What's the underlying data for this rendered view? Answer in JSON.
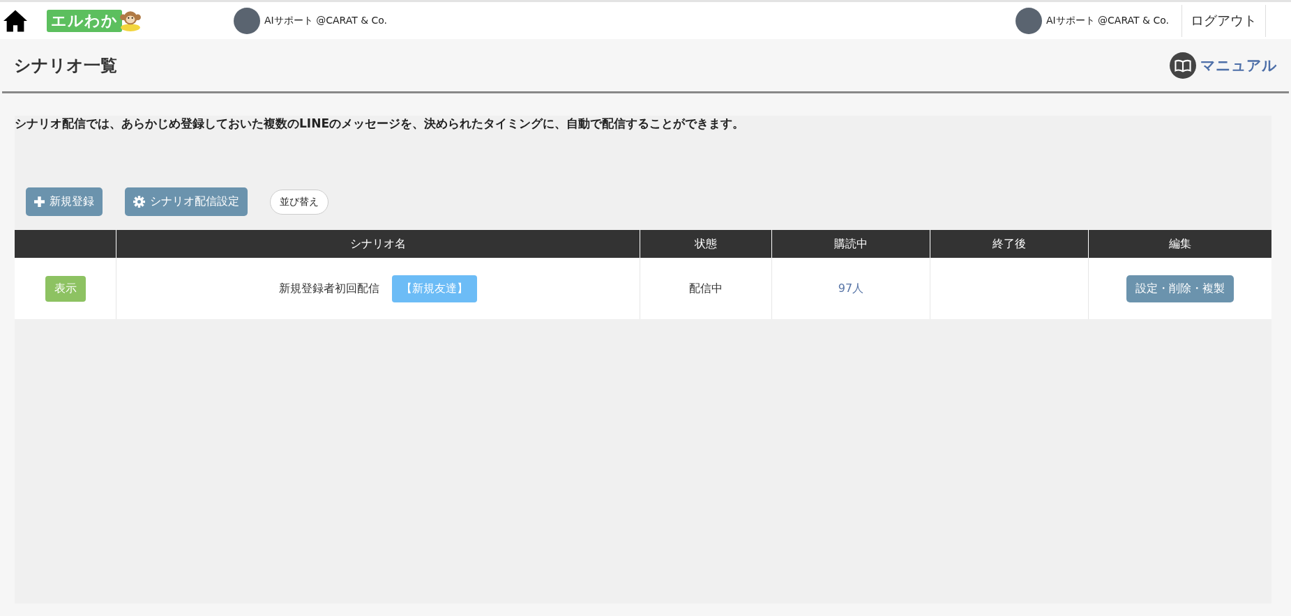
{
  "header": {
    "logo": "エルわか",
    "account_center": "AIサポート @CARAT & Co.",
    "account_right": "AIサポート @CARAT & Co.",
    "logout": "ログアウト"
  },
  "page": {
    "title": "シナリオ一覧",
    "manual_link": "マニュアル"
  },
  "description": "シナリオ配信では、あらかじめ登録しておいた複数のLINEのメッセージを、決められたタイミングに、自動で配信することができます。",
  "toolbar": [
    {
      "label": "新規登録",
      "kind": "plus"
    },
    {
      "label": "シナリオ配信設定",
      "kind": "gear"
    },
    {
      "label": "並び替え",
      "kind": "plain"
    }
  ],
  "table": {
    "columns": [
      "",
      "シナリオ名",
      "状態",
      "購読中",
      "終了後",
      "編集"
    ],
    "rows": [
      {
        "view_button": "表示",
        "name": "新規登録者初回配信",
        "tag": "【新規友達】",
        "status": "配信中",
        "subscribers": "97人",
        "after_end": "",
        "edit_button": "設定・削除・複製"
      }
    ]
  }
}
